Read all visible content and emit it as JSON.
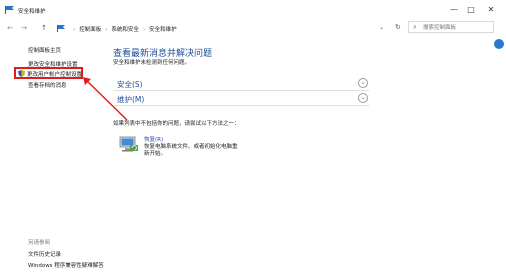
{
  "window": {
    "title": "安全和维护",
    "controls": {
      "minimize": "—",
      "maximize": "□",
      "close": "✕"
    }
  },
  "navbar": {
    "back_icon": "←",
    "forward_icon": "→",
    "up_icon": "↑",
    "breadcrumbs": [
      "控制面板",
      "系统和安全",
      "安全和维护"
    ],
    "dropdown_icon": "⌄",
    "refresh_icon": "↻",
    "search_placeholder": "搜索控制面板",
    "search_icon": "⌕"
  },
  "sidebar": {
    "items": [
      {
        "label": "控制面板主页"
      },
      {
        "label": "更改安全和维护设置"
      },
      {
        "label": "更改用户帐户控制设置"
      },
      {
        "label": "查看存档的消息"
      }
    ],
    "see_also_label": "另请参阅",
    "see_also_items": [
      {
        "label": "文件历史记录"
      },
      {
        "label": "Windows 程序兼容性疑难解答"
      }
    ]
  },
  "main": {
    "heading": "查看最新消息并解决问题",
    "subtitle": "安全和维护未检测到任何问题。",
    "sections": [
      {
        "label": "安全(S)",
        "chevron": "⌄"
      },
      {
        "label": "维护(M)",
        "chevron": "⌄"
      }
    ],
    "fix_hint": "如果列表中不包括你的问题，请尝试以下方法之一：",
    "restore": {
      "title": "恢复(R)",
      "description": "恢复电脑系统文件、或者初始化电脑重新开始。"
    }
  },
  "colors": {
    "link_blue": "#1f4d9a",
    "highlight_red": "#e11b1b",
    "help_blue": "#2b78c8"
  }
}
